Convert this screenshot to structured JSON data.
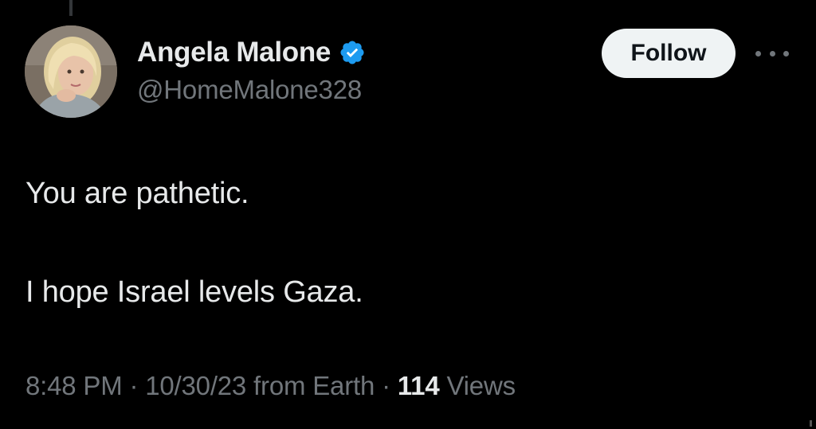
{
  "tweet": {
    "author": {
      "display_name": "Angela Malone",
      "handle": "@HomeMalone328",
      "verified": true,
      "avatar_icon": "user-avatar-photo"
    },
    "follow_label": "Follow",
    "more_icon": "more-options-icon",
    "text_lines": [
      "You are pathetic.",
      "I hope Israel levels Gaza."
    ],
    "meta": {
      "time": "8:48 PM",
      "separator": " · ",
      "date": "10/30/23",
      "source": " from Earth",
      "views_count": "114",
      "views_label": " Views"
    }
  },
  "colors": {
    "background": "#000000",
    "primary_text": "#e7e9ea",
    "secondary_text": "#71767b",
    "verified_blue": "#1d9bf0",
    "follow_bg": "#eff3f4"
  }
}
